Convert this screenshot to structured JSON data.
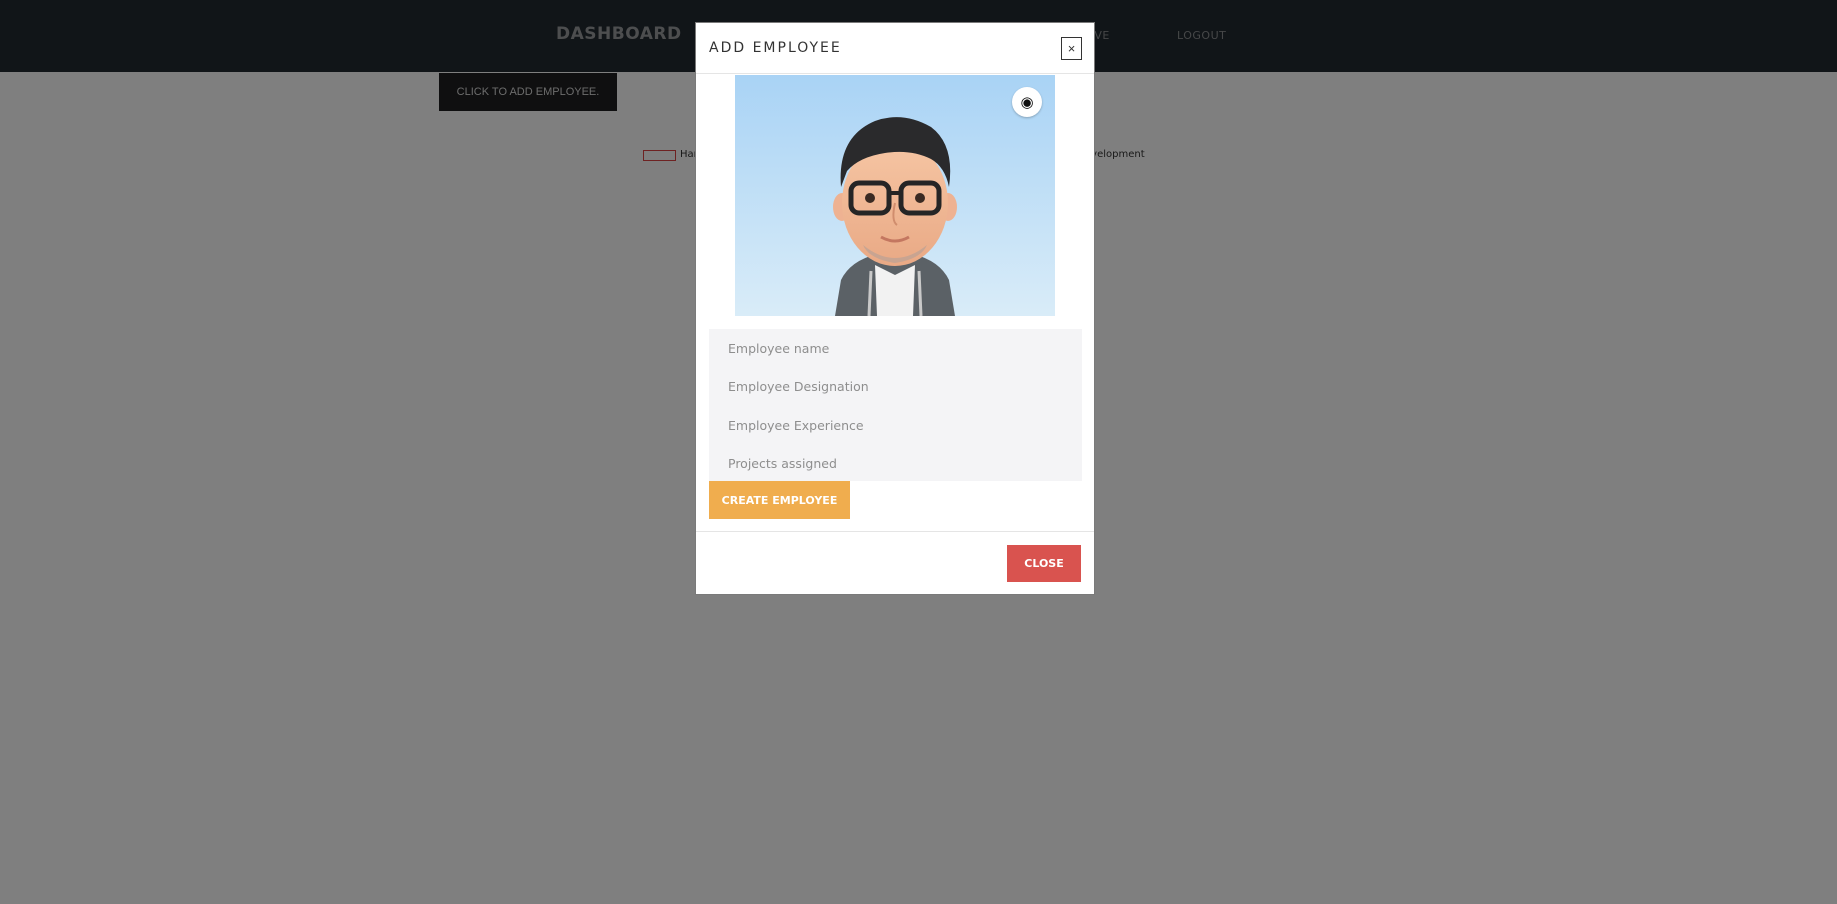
{
  "navbar": {
    "brand": "DASHBOARD",
    "links": [
      "AVE",
      "LOGOUT"
    ]
  },
  "page": {
    "add_button": "CLICK TO ADD EMPLOYEE.",
    "filter_left": "Har",
    "filter_right": "evelopment"
  },
  "modal": {
    "title": "ADD EMPLOYEE",
    "close_x": "×",
    "photo": {
      "camera_icon": "camera-icon"
    },
    "fields": [
      {
        "placeholder": "Employee name",
        "value": ""
      },
      {
        "placeholder": "Employee Designation",
        "value": ""
      },
      {
        "placeholder": "Employee Experience",
        "value": ""
      },
      {
        "placeholder": "Projects assigned",
        "value": ""
      }
    ],
    "create_button": "CREATE EMPLOYEE",
    "close_button": "CLOSE"
  },
  "colors": {
    "navbar": "#222a30",
    "create": "#f0ad4e",
    "close": "#d9534f"
  }
}
